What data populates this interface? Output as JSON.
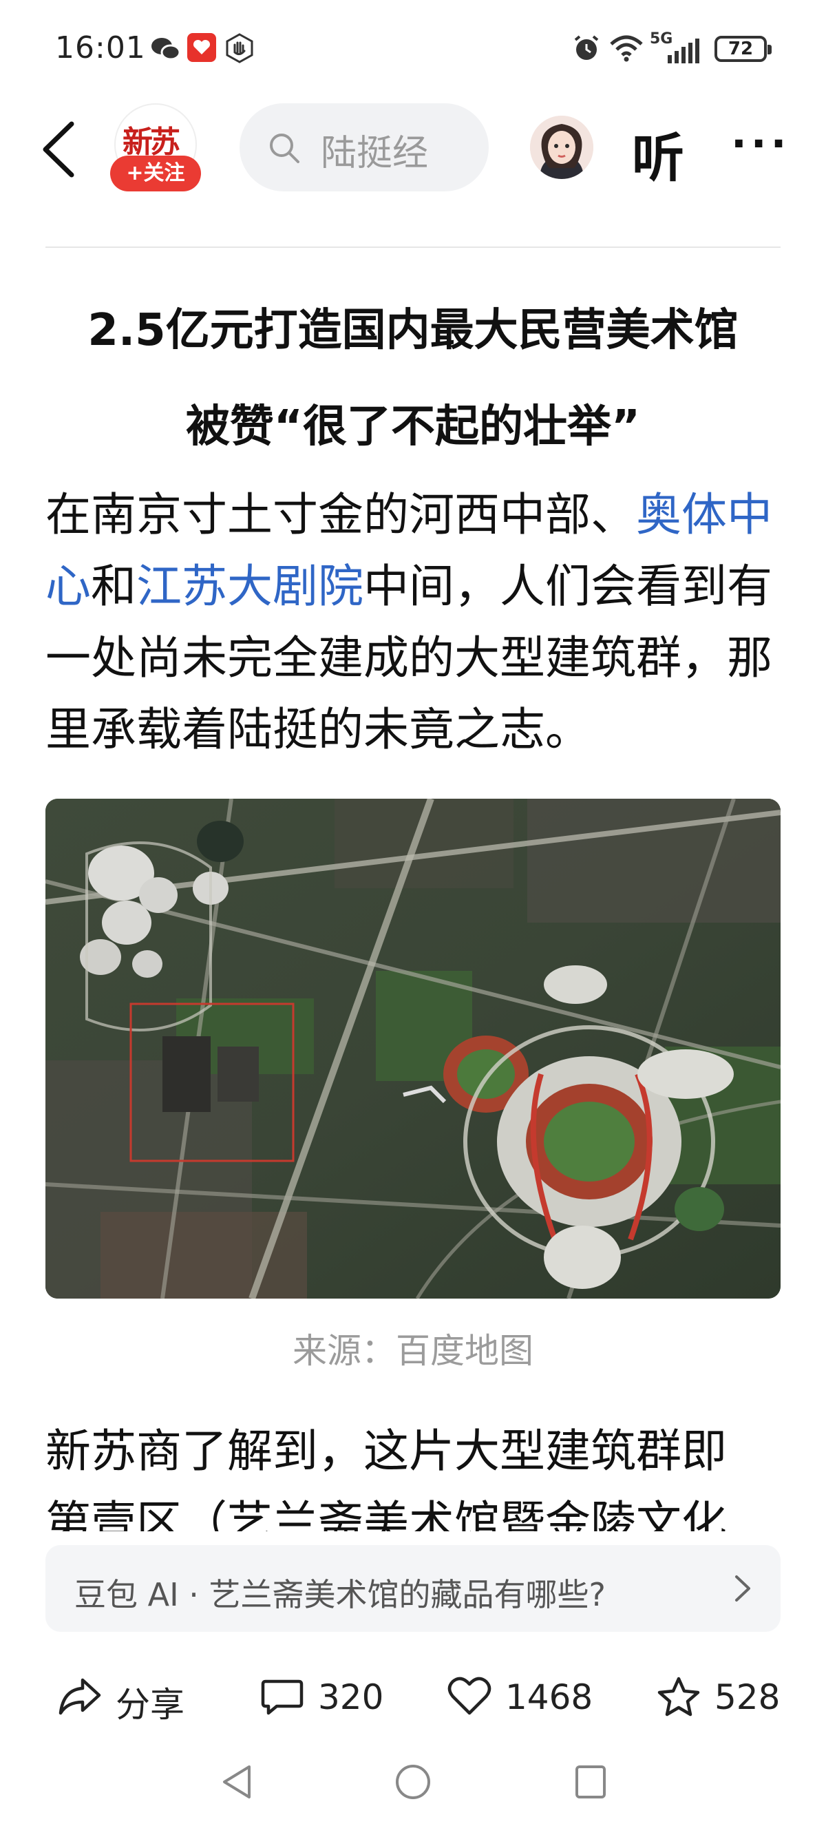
{
  "status_bar": {
    "time": "16:01",
    "network": "5G",
    "battery": "72"
  },
  "header": {
    "source_logo_text": "新苏商",
    "follow_label": "+关注",
    "search_placeholder": "陆挺经",
    "listen_label": "听",
    "more_label": "···"
  },
  "article": {
    "title_line1": "2.5亿元打造国内最大民营美术馆",
    "title_line2": "被赞“很了不起的壮举”",
    "p1_part1": "在南京寸土寸金的河西中部、",
    "p1_link1": "奥体中心",
    "p1_part2": "和",
    "p1_link2": "江苏大剧院",
    "p1_part3": "中间，人们会看到有一处尚未完全建成的大型建筑群，那里承载着陆挺的未竟之志。",
    "image_caption": "来源：百度地图",
    "p2": "新苏商了解到，这片大型建筑群即 第壹区（艺兰斋美术馆暨金陵文化"
  },
  "ai_prompt": {
    "text": "豆包 AI · 艺兰斋美术馆的藏品有哪些?"
  },
  "actions": {
    "share_label": "分享",
    "comments_count": "320",
    "likes_count": "1468",
    "favorites_count": "528"
  }
}
